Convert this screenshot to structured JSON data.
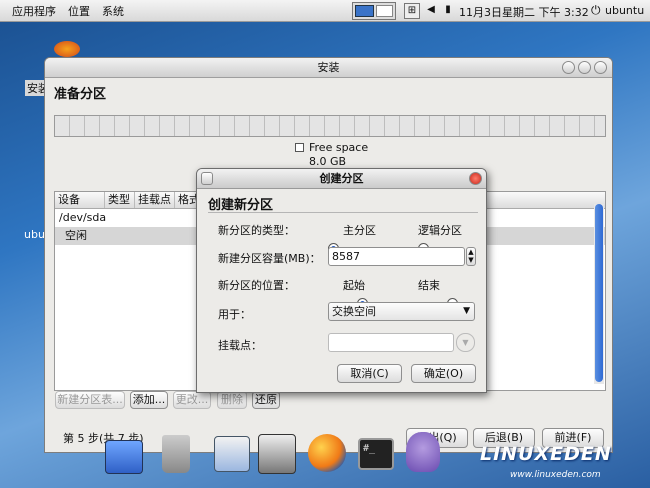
{
  "top_panel": {
    "menus": [
      "应用程序",
      "位置",
      "系统"
    ],
    "datetime": "11月3日星期二 下午 3:32",
    "user": "ubuntu"
  },
  "desktop": {
    "install_icon_label": "安装",
    "ubuntu_label": "ubu"
  },
  "window": {
    "title": "安装",
    "heading": "准备分区",
    "free_space_label": "Free space",
    "free_space_size": "8.0 GB",
    "table": {
      "headers": [
        "设备",
        "类型",
        "挂载点",
        "格式"
      ],
      "rows": [
        {
          "device": "/dev/sda",
          "selected": false
        },
        {
          "device": "空闲",
          "selected": true
        }
      ]
    },
    "buttons": {
      "new_table": "新建分区表...",
      "add": "添加...",
      "change": "更改...",
      "delete": "删除",
      "revert": "还原"
    },
    "step": "第 5 步(共 7 步)",
    "nav": {
      "quit": "退出(Q)",
      "back": "后退(B)",
      "forward": "前进(F)"
    }
  },
  "dialog": {
    "title": "创建分区",
    "heading": "创建新分区",
    "type_label": "新分区的类型：",
    "type_primary": "主分区",
    "type_logical": "逻辑分区",
    "size_label": "新建分区容量(MB)：",
    "size_value": "8587",
    "position_label": "新分区的位置：",
    "pos_begin": "起始",
    "pos_end": "结束",
    "use_label": "用于：",
    "use_value": "交换空间",
    "mount_label": "挂载点：",
    "mount_value": "",
    "cancel": "取消(C)",
    "ok": "确定(O)"
  },
  "watermark": {
    "logo": "LINUXEDEN",
    "url": "www.linuxeden.com"
  }
}
